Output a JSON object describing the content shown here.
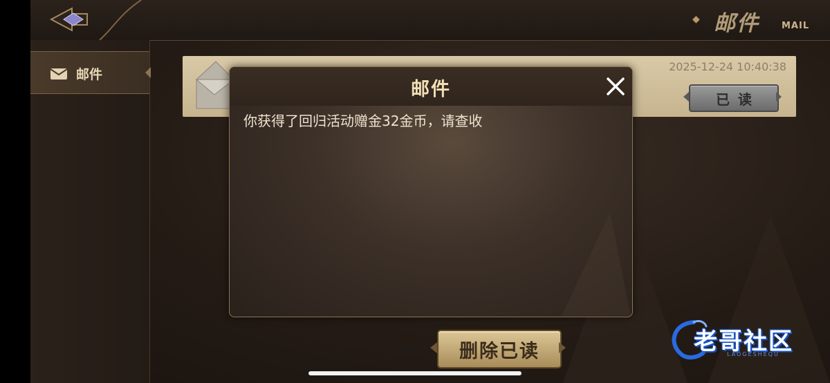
{
  "header": {
    "title": "邮件",
    "subtitle": "MAIL",
    "back_icon": "back-arrow-icon"
  },
  "sidebar": {
    "items": [
      {
        "label": "邮件",
        "icon": "envelope-icon",
        "selected": true
      }
    ]
  },
  "mail_list": {
    "items": [
      {
        "timestamp": "2025-12-24 10:40:38",
        "status_label": "已读",
        "icon": "envelope-open-icon"
      }
    ]
  },
  "dialog": {
    "title": "邮件",
    "message": "你获得了回归活动赠金32金币，请查收",
    "close_icon": "close-icon"
  },
  "actions": {
    "delete_read_label": "删除已读"
  },
  "watermark": {
    "text": "老哥社区",
    "sub": "LAOGESHEQU"
  },
  "colors": {
    "panel_bg": "#241b15",
    "gold_text": "#f2dfb6",
    "mail_item_bg": "#d9c9a7",
    "watermark_blue": "#1a56c8"
  }
}
